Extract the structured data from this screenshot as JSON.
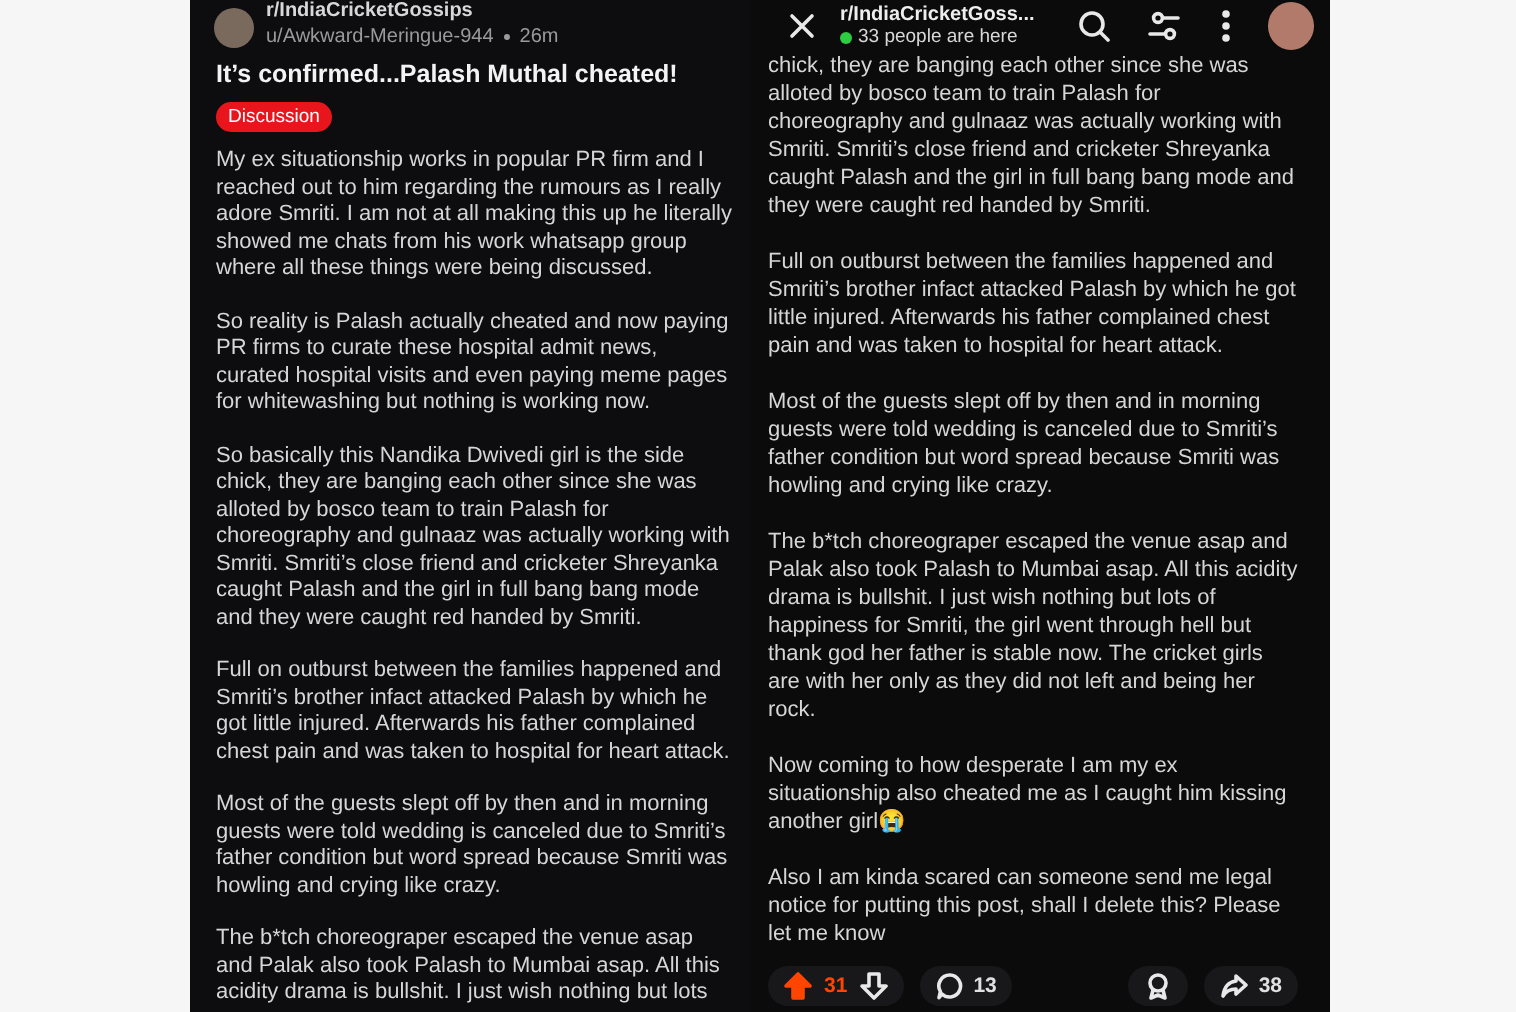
{
  "panels": [
    {
      "kind": "post_start",
      "subreddit": "r/IndiaCricketGossips",
      "author": "u/Awkward-Meringue-944",
      "time": "26m",
      "title": "It’s confirmed...Palash Muthal cheated!",
      "flair": "Discussion",
      "paragraphs": [
        "My ex situationship works in popular PR firm and I reached out to him regarding the rumours as I really adore Smriti. I am not at all making this up he literally showed me chats from his work whatsapp group where all these things were being discussed.",
        "So reality is Palash actually cheated and now paying PR firms to curate these hospital admit news, curated hospital visits and even paying meme pages for whitewashing but nothing is working now.",
        "So basically this Nandika Dwivedi girl is the side chick, they are banging each other since she was alloted by bosco team to train Palash for choreography and gulnaaz was actually working with Smriti. Smriti’s close friend and cricketer Shreyanka caught Palash and the girl in full bang bang mode and they were caught red handed by Smriti.",
        "Full on outburst between the families happened and Smriti’s brother infact attacked Palash by which he got little injured. Afterwards his father complained chest pain and was taken to hospital for heart attack.",
        "Most of the guests slept off by then and in morning guests were told wedding is canceled due to Smriti’s father condition but word spread because Smriti was howling and crying like crazy.",
        "The b*tch choreograper escaped the venue asap and Palak also took Palash to Mumbai asap. All this acidity drama is bullshit. I just wish nothing but lots"
      ]
    },
    {
      "kind": "post_end",
      "subreddit": "r/IndiaCricketGoss...",
      "online": "33 people are here",
      "paragraphs": [
        "chick, they are banging each other since she was alloted by bosco team to train Palash for choreography and gulnaaz was actually working with Smriti. Smriti’s close friend and cricketer Shreyanka caught Palash and the girl in full bang bang mode and they were caught red handed by Smriti.",
        "Full on outburst between the families happened and Smriti’s brother infact attacked Palash by which he got little injured. Afterwards his father complained chest pain and was taken to hospital for heart attack.",
        "Most of the guests slept off by then and in morning guests were told wedding is canceled due to Smriti’s father condition but word spread because Smriti was howling and crying like crazy.",
        "The b*tch choreograper escaped the venue asap and Palak also took Palash to Mumbai asap. All this acidity drama is bullshit. I just wish nothing but lots of happiness for Smriti, the girl went through hell but thank god her father is stable now. The cricket girls are with her only as they did not left and being her rock.",
        "Now coming to how desperate I am my ex situationship also cheated me as I caught him kissing another girl😭",
        "Also I am kinda scared can someone send me legal notice for putting this post, shall I delete this? Please let me know"
      ],
      "actions": {
        "upvoted": true,
        "upvotes": "31",
        "comments": "13",
        "shares": "38"
      }
    }
  ]
}
